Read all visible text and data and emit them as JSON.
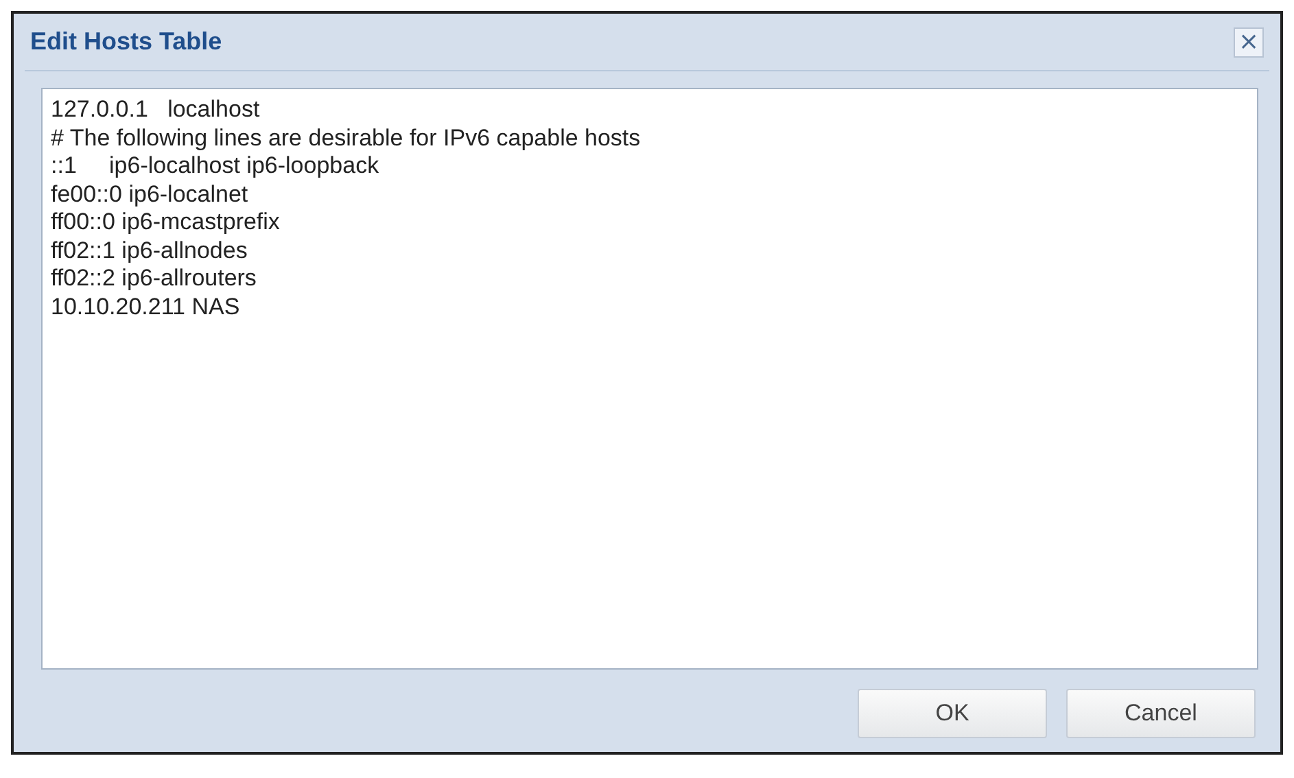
{
  "window": {
    "title": "Edit Hosts Table",
    "close": "×"
  },
  "editor": {
    "lines": [
      "127.0.0.1   localhost",
      "# The following lines are desirable for IPv6 capable hosts",
      "::1     ip6-localhost ip6-loopback",
      "fe00::0 ip6-localnet",
      "ff00::0 ip6-mcastprefix",
      "ff02::1 ip6-allnodes",
      "ff02::2 ip6-allrouters",
      "10.10.20.211 NAS"
    ]
  },
  "buttons": [
    "OK",
    "Cancel"
  ]
}
